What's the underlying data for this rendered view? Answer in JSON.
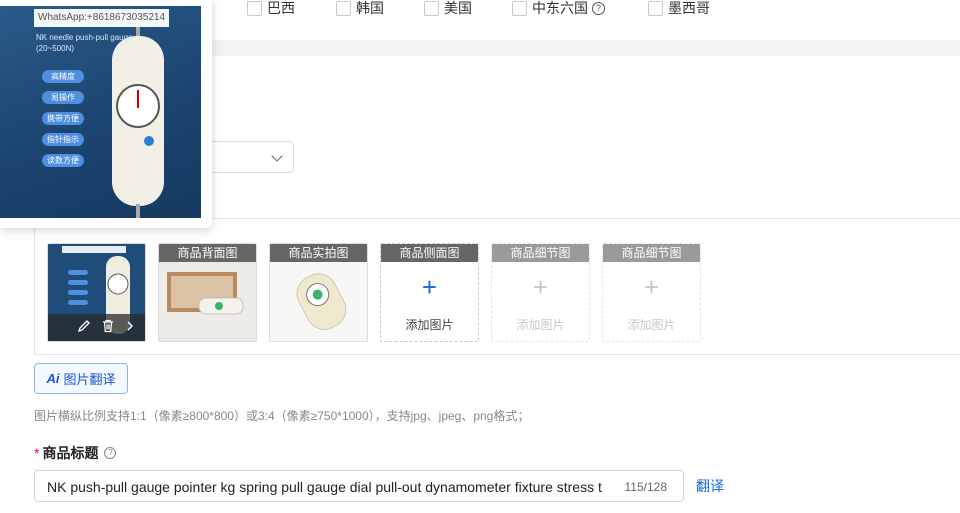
{
  "countries": [
    {
      "name": "巴西"
    },
    {
      "name": "韩国"
    },
    {
      "name": "美国"
    },
    {
      "name": "中东六国"
    },
    {
      "name": "墨西哥"
    }
  ],
  "images": {
    "slots": [
      {
        "header": "",
        "state": "filled"
      },
      {
        "header": "商品背面图",
        "state": "filled"
      },
      {
        "header": "商品实拍图",
        "state": "filled"
      },
      {
        "header": "商品侧面图",
        "state": "empty",
        "add_label": "添加图片"
      },
      {
        "header": "商品细节图",
        "state": "disabled",
        "add_label": "添加图片"
      },
      {
        "header": "商品细节图",
        "state": "disabled",
        "add_label": "添加图片"
      }
    ],
    "translate_button": "图片翻译",
    "hint": "图片横纵比例支持1:1（像素≥800*800）或3:4（像素≥750*1000），支持jpg、jpeg、png格式；"
  },
  "title_field": {
    "label": "商品标题",
    "value": "NK push-pull gauge pointer kg spring pull gauge dial pull-out dynamometer fixture stress t",
    "count": "115/128",
    "translate_link": "翻译"
  },
  "preview": {
    "watermark": "WhatsApp:+8618673035214",
    "product_name": "NK needle push-pull gauge",
    "range": "(20~500N)",
    "features": [
      "高精度",
      "易操作",
      "携带方便",
      "指针指示",
      "读数方便"
    ]
  },
  "colors": {
    "accent": "#1668dc",
    "required": "#ff0033",
    "header_gray": "#666666"
  }
}
